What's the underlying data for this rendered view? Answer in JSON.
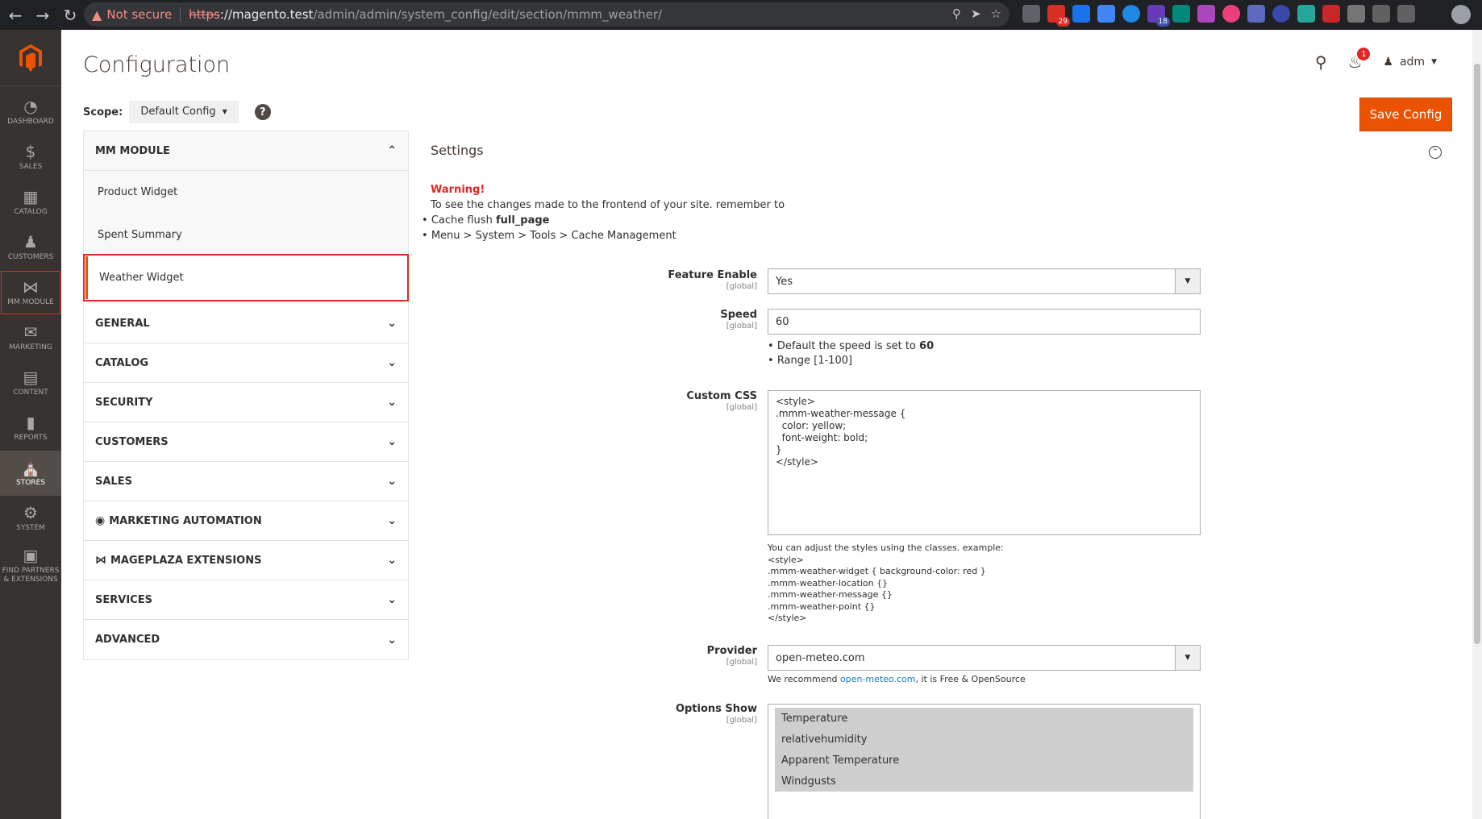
{
  "browser": {
    "not_secure": "Not secure",
    "url_scheme": "https",
    "url_host": "://magento.test",
    "url_path": "/admin/admin/system_config/edit/section/mmm_weather/",
    "ext_badge_1": "29",
    "ext_badge_2": "18"
  },
  "admin_nav": [
    {
      "label": "DASHBOARD",
      "icon": "dashboard-icon"
    },
    {
      "label": "SALES",
      "icon": "dollar-icon"
    },
    {
      "label": "CATALOG",
      "icon": "cube-icon"
    },
    {
      "label": "CUSTOMERS",
      "icon": "person-icon"
    },
    {
      "label": "MM MODULE",
      "icon": "module-icon"
    },
    {
      "label": "MARKETING",
      "icon": "megaphone-icon"
    },
    {
      "label": "CONTENT",
      "icon": "content-icon"
    },
    {
      "label": "REPORTS",
      "icon": "bar-chart-icon"
    },
    {
      "label": "STORES",
      "icon": "store-icon"
    },
    {
      "label": "SYSTEM",
      "icon": "gear-icon"
    },
    {
      "label": "FIND PARTNERS & EXTENSIONS",
      "icon": "box-icon"
    }
  ],
  "header": {
    "title": "Configuration",
    "user": "adm",
    "notifications": "1"
  },
  "scope": {
    "label": "Scope:",
    "value": "Default Config",
    "help": "?"
  },
  "save_button": "Save Config",
  "tabs": {
    "open_group": "MM MODULE",
    "items": [
      "Product Widget",
      "Spent Summary",
      "Weather Widget"
    ],
    "groups": [
      "GENERAL",
      "CATALOG",
      "SECURITY",
      "CUSTOMERS",
      "SALES",
      "MARKETING AUTOMATION",
      "MAGEPLAZA EXTENSIONS",
      "SERVICES",
      "ADVANCED"
    ]
  },
  "settings": {
    "title": "Settings",
    "warning_title": "Warning!",
    "warning_text": "To see the changes made to the frontend of your site. remember to",
    "warning_item1_prefix": "Cache flush ",
    "warning_item1_bold": "full_page",
    "warning_item2": "Menu > System > Tools > Cache Management"
  },
  "fields": {
    "feature_enable": {
      "label": "Feature Enable",
      "scope": "[global]",
      "value": "Yes"
    },
    "speed": {
      "label": "Speed",
      "scope": "[global]",
      "value": "60",
      "note1_prefix": "Default the speed is set to ",
      "note1_bold": "60",
      "note2": "Range [1-100]"
    },
    "custom_css": {
      "label": "Custom CSS",
      "scope": "[global]",
      "value": "<style>\n.mmm-weather-message {\n  color: yellow;\n  font-weight: bold;\n}\n</style>",
      "note": "You can adjust the styles using the classes. example:\n<style>\n.mmm-weather-widget { background-color: red }\n.mmm-weather-location {}\n.mmm-weather-message {}\n.mmm-weather-point {}\n</style>"
    },
    "provider": {
      "label": "Provider",
      "scope": "[global]",
      "value": "open-meteo.com",
      "note_prefix": "We recommend ",
      "note_link": "open-meteo.com",
      "note_suffix": ", it is Free & OpenSource"
    },
    "options_show": {
      "label": "Options Show",
      "scope": "[global]",
      "options": [
        "Temperature",
        "relativehumidity",
        "Apparent Temperature",
        "Windgusts"
      ]
    }
  }
}
